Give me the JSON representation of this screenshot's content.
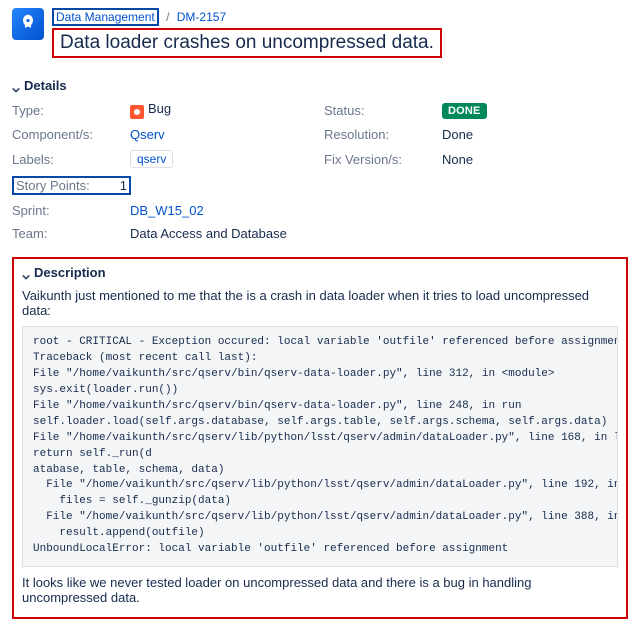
{
  "breadcrumb": {
    "project": "Data Management",
    "issue_key": "DM-2157"
  },
  "title": "Data loader crashes on uncompressed data.",
  "sections": {
    "details": "Details",
    "description": "Description"
  },
  "details": {
    "type_label": "Type:",
    "type_value": "Bug",
    "status_label": "Status:",
    "status_value": "DONE",
    "components_label": "Component/s:",
    "components_value": "Qserv",
    "resolution_label": "Resolution:",
    "resolution_value": "Done",
    "labels_label": "Labels:",
    "labels_value": "qserv",
    "fixversion_label": "Fix Version/s:",
    "fixversion_value": "None",
    "storypoints_label": "Story Points:",
    "storypoints_value": "1",
    "sprint_label": "Sprint:",
    "sprint_value": "DB_W15_02",
    "team_label": "Team:",
    "team_value": "Data Access and Database"
  },
  "description": {
    "intro": "Vaikunth just mentioned to me that the is a crash in data loader when it tries to load uncompressed data:",
    "trace": "root - CRITICAL - Exception occured: local variable 'outfile' referenced before assignment\nTraceback (most recent call last):\nFile \"/home/vaikunth/src/qserv/bin/qserv-data-loader.py\", line 312, in <module>\nsys.exit(loader.run())\nFile \"/home/vaikunth/src/qserv/bin/qserv-data-loader.py\", line 248, in run\nself.loader.load(self.args.database, self.args.table, self.args.schema, self.args.data)\nFile \"/home/vaikunth/src/qserv/lib/python/lsst/qserv/admin/dataLoader.py\", line 168, in load\nreturn self._run(d\natabase, table, schema, data)\n  File \"/home/vaikunth/src/qserv/lib/python/lsst/qserv/admin/dataLoader.py\", line 192, in _run\n    files = self._gunzip(data)\n  File \"/home/vaikunth/src/qserv/lib/python/lsst/qserv/admin/dataLoader.py\", line 388, in _gunzip\n    result.append(outfile)\nUnboundLocalError: local variable 'outfile' referenced before assignment",
    "outro": "It looks like we never tested loader on uncompressed data and there is a bug in handling uncompressed data."
  }
}
